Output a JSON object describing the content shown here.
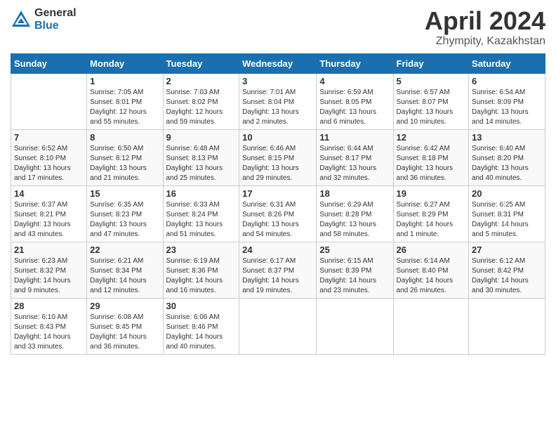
{
  "header": {
    "logo_general": "General",
    "logo_blue": "Blue",
    "month": "April 2024",
    "location": "Zhympity, Kazakhstan"
  },
  "days_of_week": [
    "Sunday",
    "Monday",
    "Tuesday",
    "Wednesday",
    "Thursday",
    "Friday",
    "Saturday"
  ],
  "weeks": [
    [
      {
        "day": "",
        "info": ""
      },
      {
        "day": "1",
        "info": "Sunrise: 7:05 AM\nSunset: 8:01 PM\nDaylight: 12 hours\nand 55 minutes."
      },
      {
        "day": "2",
        "info": "Sunrise: 7:03 AM\nSunset: 8:02 PM\nDaylight: 12 hours\nand 59 minutes."
      },
      {
        "day": "3",
        "info": "Sunrise: 7:01 AM\nSunset: 8:04 PM\nDaylight: 13 hours\nand 2 minutes."
      },
      {
        "day": "4",
        "info": "Sunrise: 6:59 AM\nSunset: 8:05 PM\nDaylight: 13 hours\nand 6 minutes."
      },
      {
        "day": "5",
        "info": "Sunrise: 6:57 AM\nSunset: 8:07 PM\nDaylight: 13 hours\nand 10 minutes."
      },
      {
        "day": "6",
        "info": "Sunrise: 6:54 AM\nSunset: 8:09 PM\nDaylight: 13 hours\nand 14 minutes."
      }
    ],
    [
      {
        "day": "7",
        "info": "Sunrise: 6:52 AM\nSunset: 8:10 PM\nDaylight: 13 hours\nand 17 minutes."
      },
      {
        "day": "8",
        "info": "Sunrise: 6:50 AM\nSunset: 8:12 PM\nDaylight: 13 hours\nand 21 minutes."
      },
      {
        "day": "9",
        "info": "Sunrise: 6:48 AM\nSunset: 8:13 PM\nDaylight: 13 hours\nand 25 minutes."
      },
      {
        "day": "10",
        "info": "Sunrise: 6:46 AM\nSunset: 8:15 PM\nDaylight: 13 hours\nand 29 minutes."
      },
      {
        "day": "11",
        "info": "Sunrise: 6:44 AM\nSunset: 8:17 PM\nDaylight: 13 hours\nand 32 minutes."
      },
      {
        "day": "12",
        "info": "Sunrise: 6:42 AM\nSunset: 8:18 PM\nDaylight: 13 hours\nand 36 minutes."
      },
      {
        "day": "13",
        "info": "Sunrise: 6:40 AM\nSunset: 8:20 PM\nDaylight: 13 hours\nand 40 minutes."
      }
    ],
    [
      {
        "day": "14",
        "info": "Sunrise: 6:37 AM\nSunset: 8:21 PM\nDaylight: 13 hours\nand 43 minutes."
      },
      {
        "day": "15",
        "info": "Sunrise: 6:35 AM\nSunset: 8:23 PM\nDaylight: 13 hours\nand 47 minutes."
      },
      {
        "day": "16",
        "info": "Sunrise: 6:33 AM\nSunset: 8:24 PM\nDaylight: 13 hours\nand 51 minutes."
      },
      {
        "day": "17",
        "info": "Sunrise: 6:31 AM\nSunset: 8:26 PM\nDaylight: 13 hours\nand 54 minutes."
      },
      {
        "day": "18",
        "info": "Sunrise: 6:29 AM\nSunset: 8:28 PM\nDaylight: 13 hours\nand 58 minutes."
      },
      {
        "day": "19",
        "info": "Sunrise: 6:27 AM\nSunset: 8:29 PM\nDaylight: 14 hours\nand 1 minute."
      },
      {
        "day": "20",
        "info": "Sunrise: 6:25 AM\nSunset: 8:31 PM\nDaylight: 14 hours\nand 5 minutes."
      }
    ],
    [
      {
        "day": "21",
        "info": "Sunrise: 6:23 AM\nSunset: 8:32 PM\nDaylight: 14 hours\nand 9 minutes."
      },
      {
        "day": "22",
        "info": "Sunrise: 6:21 AM\nSunset: 8:34 PM\nDaylight: 14 hours\nand 12 minutes."
      },
      {
        "day": "23",
        "info": "Sunrise: 6:19 AM\nSunset: 8:36 PM\nDaylight: 14 hours\nand 16 minutes."
      },
      {
        "day": "24",
        "info": "Sunrise: 6:17 AM\nSunset: 8:37 PM\nDaylight: 14 hours\nand 19 minutes."
      },
      {
        "day": "25",
        "info": "Sunrise: 6:15 AM\nSunset: 8:39 PM\nDaylight: 14 hours\nand 23 minutes."
      },
      {
        "day": "26",
        "info": "Sunrise: 6:14 AM\nSunset: 8:40 PM\nDaylight: 14 hours\nand 26 minutes."
      },
      {
        "day": "27",
        "info": "Sunrise: 6:12 AM\nSunset: 8:42 PM\nDaylight: 14 hours\nand 30 minutes."
      }
    ],
    [
      {
        "day": "28",
        "info": "Sunrise: 6:10 AM\nSunset: 8:43 PM\nDaylight: 14 hours\nand 33 minutes."
      },
      {
        "day": "29",
        "info": "Sunrise: 6:08 AM\nSunset: 8:45 PM\nDaylight: 14 hours\nand 36 minutes."
      },
      {
        "day": "30",
        "info": "Sunrise: 6:06 AM\nSunset: 8:46 PM\nDaylight: 14 hours\nand 40 minutes."
      },
      {
        "day": "",
        "info": ""
      },
      {
        "day": "",
        "info": ""
      },
      {
        "day": "",
        "info": ""
      },
      {
        "day": "",
        "info": ""
      }
    ]
  ]
}
